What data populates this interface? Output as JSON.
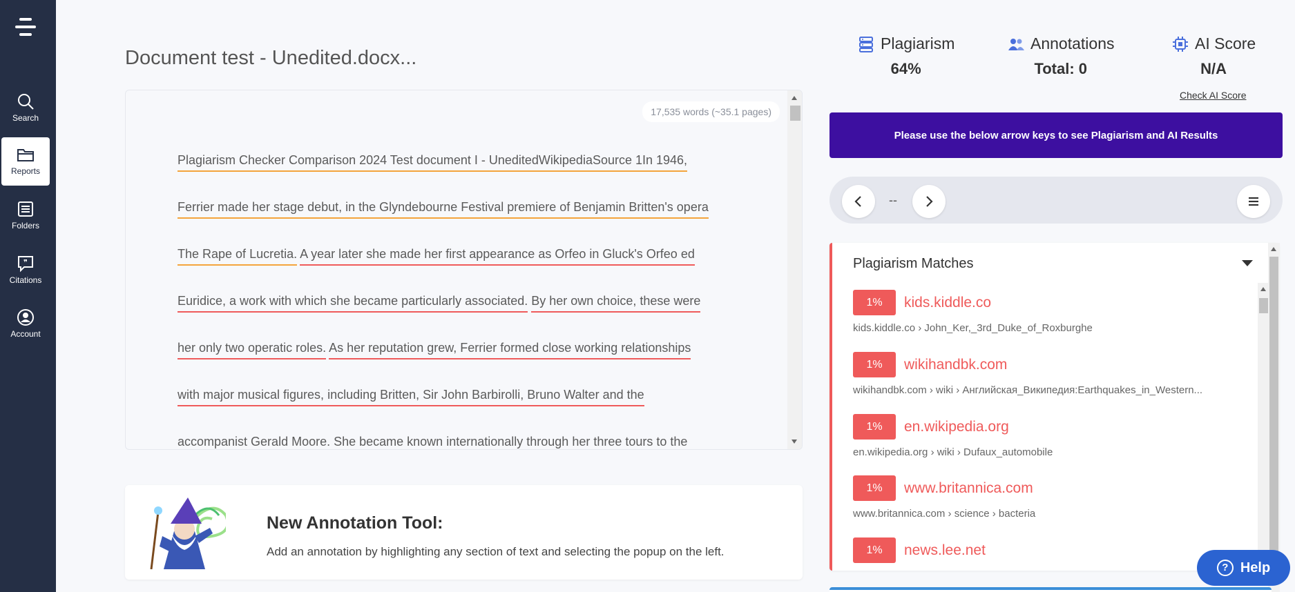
{
  "sidebar": {
    "items": [
      {
        "label": "Search",
        "icon": "search-icon"
      },
      {
        "label": "Reports",
        "icon": "folder-open-icon"
      },
      {
        "label": "Folders",
        "icon": "list-icon"
      },
      {
        "label": "Citations",
        "icon": "quote-bubble-icon"
      },
      {
        "label": "Account",
        "icon": "user-circle-icon"
      }
    ],
    "active": "Reports"
  },
  "document": {
    "title": "Document test - Unedited.docx...",
    "word_count": "17,535 words (~35.1 pages)",
    "lines": [
      [
        {
          "t": "Plagiarism Checker Comparison 2024 Test document I - UneditedWikipediaSource 1In 1946,",
          "hl": "o"
        }
      ],
      [
        {
          "t": "Ferrier made her stage debut, in the Glyndebourne Festival premiere of Benjamin Britten's opera",
          "hl": "o"
        }
      ],
      [
        {
          "t": "The Rape of Lucretia.",
          "hl": "o"
        },
        {
          "t": " ",
          "hl": ""
        },
        {
          "t": "A year later she made her first appearance as Orfeo in Gluck's Orfeo ed",
          "hl": "r"
        }
      ],
      [
        {
          "t": "Euridice, a work with which she became particularly associated.",
          "hl": "r"
        },
        {
          "t": " ",
          "hl": ""
        },
        {
          "t": "By her own choice, these were",
          "hl": "r"
        }
      ],
      [
        {
          "t": "her only two operatic roles.",
          "hl": "r"
        },
        {
          "t": " ",
          "hl": ""
        },
        {
          "t": "As her reputation grew, Ferrier formed close working relationships",
          "hl": "r"
        }
      ],
      [
        {
          "t": "with major musical figures, including Britten, Sir John Barbirolli, Bruno Walter and the",
          "hl": "r"
        }
      ],
      [
        {
          "t": "accompanist Gerald Moore. She became known internationally through her three tours to the",
          "hl": "r"
        }
      ]
    ]
  },
  "annotation": {
    "title": "New Annotation Tool:",
    "text": "Add an annotation by highlighting any section of text and selecting the popup on the left."
  },
  "stats": {
    "plagiarism": {
      "label": "Plagiarism",
      "value": "64%"
    },
    "annotations": {
      "label": "Annotations",
      "value": "Total: 0"
    },
    "ai_score": {
      "label": "AI Score",
      "value": "N/A",
      "link": "Check AI Score"
    }
  },
  "banner": "Please use the below arrow keys to see Plagiarism and AI Results",
  "navigator": {
    "counter": "--"
  },
  "matches": {
    "title": "Plagiarism Matches",
    "items": [
      {
        "pct": "1%",
        "domain": "kids.kiddle.co",
        "crumb": "kids.kiddle.co › John_Ker,_3rd_Duke_of_Roxburghe"
      },
      {
        "pct": "1%",
        "domain": "wikihandbk.com",
        "crumb": "wikihandbk.com › wiki › Английская_Википедия:Earthquakes_in_Western..."
      },
      {
        "pct": "1%",
        "domain": "en.wikipedia.org",
        "crumb": "en.wikipedia.org › wiki › Dufaux_automobile"
      },
      {
        "pct": "1%",
        "domain": "www.britannica.com",
        "crumb": "www.britannica.com › science › bacteria"
      },
      {
        "pct": "1%",
        "domain": "news.lee.net",
        "crumb": ""
      }
    ]
  },
  "help": {
    "label": "Help"
  },
  "colors": {
    "sidebar": "#252f45",
    "banner": "#3d0fa0",
    "match_red": "#ef5a5a",
    "highlight_orange": "#f4a43b",
    "help_blue": "#2b63d1"
  }
}
